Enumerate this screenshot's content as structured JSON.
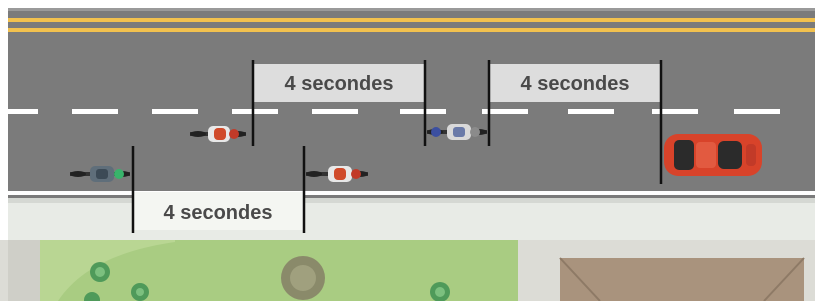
{
  "colors": {
    "road": "#7b7b7b",
    "yellow_line": "#f2c14e",
    "lane_dash": "#ffffff",
    "label_box": "#dddddd",
    "label_text": "#4a4a4a",
    "sidewalk": "#e8ebe6",
    "grass": "#a9cc82",
    "grass_dark": "#8fb86a",
    "path": "#c9c9c3",
    "roof": "#a9937d",
    "lot": "#dcdcd6",
    "car": "#d8432a"
  },
  "gap_labels": {
    "top_left": "4 secondes",
    "top_right": "4 secondes",
    "bottom": "4 secondes"
  },
  "vehicles": [
    {
      "kind": "motorcycle",
      "jacket": "red-white",
      "icon": "motorcycle-icon"
    },
    {
      "kind": "motorcycle",
      "jacket": "green",
      "icon": "motorcycle-icon"
    },
    {
      "kind": "motorcycle",
      "jacket": "red-white",
      "icon": "motorcycle-icon"
    },
    {
      "kind": "motorcycle",
      "jacket": "blue",
      "icon": "motorcycle-icon"
    },
    {
      "kind": "car",
      "color": "red",
      "icon": "car-icon"
    }
  ]
}
